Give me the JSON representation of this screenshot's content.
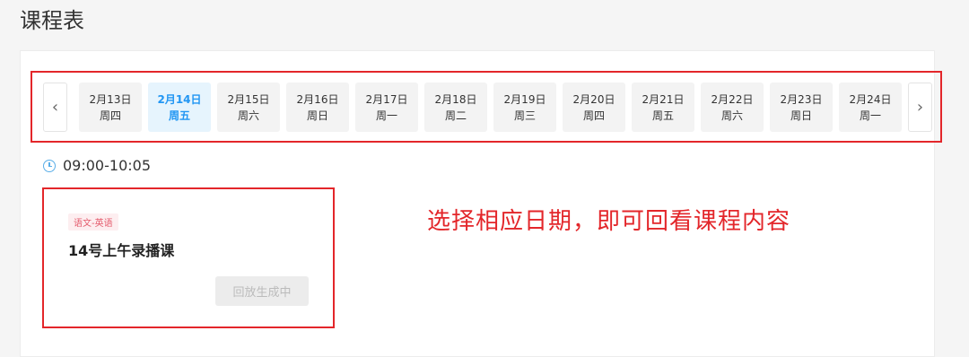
{
  "page_title": "课程表",
  "nav": {
    "prev_icon": "chevron-left-icon",
    "next_icon": "chevron-right-icon"
  },
  "dates": [
    {
      "date": "2月13日",
      "weekday": "周四",
      "active": false
    },
    {
      "date": "2月14日",
      "weekday": "周五",
      "active": true
    },
    {
      "date": "2月15日",
      "weekday": "周六",
      "active": false
    },
    {
      "date": "2月16日",
      "weekday": "周日",
      "active": false
    },
    {
      "date": "2月17日",
      "weekday": "周一",
      "active": false
    },
    {
      "date": "2月18日",
      "weekday": "周二",
      "active": false
    },
    {
      "date": "2月19日",
      "weekday": "周三",
      "active": false
    },
    {
      "date": "2月20日",
      "weekday": "周四",
      "active": false
    },
    {
      "date": "2月21日",
      "weekday": "周五",
      "active": false
    },
    {
      "date": "2月22日",
      "weekday": "周六",
      "active": false
    },
    {
      "date": "2月23日",
      "weekday": "周日",
      "active": false
    },
    {
      "date": "2月24日",
      "weekday": "周一",
      "active": false
    }
  ],
  "schedule": {
    "time": "09:00-10:05",
    "course": {
      "tag": "语文-英语",
      "title": "14号上午录播课",
      "replay_button": "回放生成中"
    }
  },
  "annotation": "选择相应日期，即可回看课程内容",
  "colors": {
    "accent": "#2196f3",
    "highlight": "#e3262a"
  }
}
